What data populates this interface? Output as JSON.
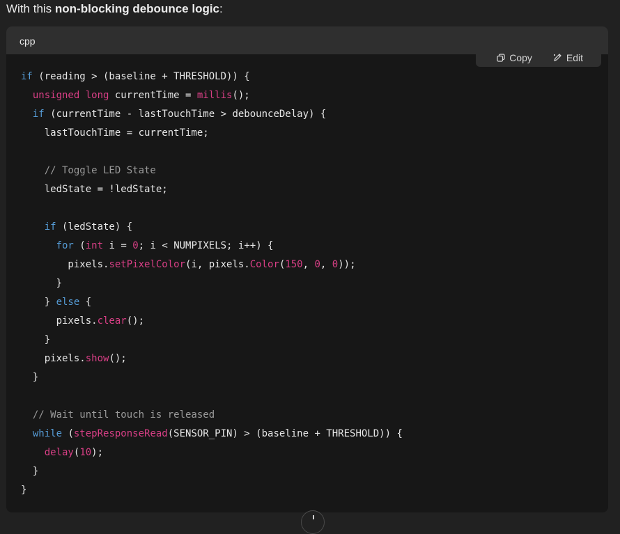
{
  "intro": {
    "prefix": "With this ",
    "bold": "non-blocking debounce logic",
    "suffix": ":"
  },
  "code_block": {
    "language": "cpp",
    "copy_label": "Copy",
    "edit_label": "Edit",
    "icons": {
      "copy": "copy-icon",
      "edit": "edit-icon"
    },
    "colors": {
      "keyword": "#569cd6",
      "type_fn_number": "#d93f86",
      "comment": "#9a9a9a",
      "text": "#e6e6e6",
      "background": "#171717",
      "header": "#2f2f2f"
    },
    "lines": [
      [
        [
          "kw",
          "if"
        ],
        [
          "p",
          " (reading > (baseline + THRESHOLD)) {"
        ]
      ],
      [
        [
          "p",
          "  "
        ],
        [
          "type",
          "unsigned long"
        ],
        [
          "p",
          " currentTime = "
        ],
        [
          "fn",
          "millis"
        ],
        [
          "p",
          "();"
        ]
      ],
      [
        [
          "p",
          "  "
        ],
        [
          "kw",
          "if"
        ],
        [
          "p",
          " (currentTime - lastTouchTime > debounceDelay) {"
        ]
      ],
      [
        [
          "p",
          "    lastTouchTime = currentTime;"
        ]
      ],
      [],
      [
        [
          "p",
          "    "
        ],
        [
          "comment",
          "// Toggle LED State"
        ]
      ],
      [
        [
          "p",
          "    ledState = !ledState;"
        ]
      ],
      [],
      [
        [
          "p",
          "    "
        ],
        [
          "kw",
          "if"
        ],
        [
          "p",
          " (ledState) {"
        ]
      ],
      [
        [
          "p",
          "      "
        ],
        [
          "kw",
          "for"
        ],
        [
          "p",
          " ("
        ],
        [
          "type",
          "int"
        ],
        [
          "p",
          " i = "
        ],
        [
          "num",
          "0"
        ],
        [
          "p",
          "; i < NUMPIXELS; i++) {"
        ]
      ],
      [
        [
          "p",
          "        pixels."
        ],
        [
          "fn",
          "setPixelColor"
        ],
        [
          "p",
          "(i, pixels."
        ],
        [
          "fn",
          "Color"
        ],
        [
          "p",
          "("
        ],
        [
          "num",
          "150"
        ],
        [
          "p",
          ", "
        ],
        [
          "num",
          "0"
        ],
        [
          "p",
          ", "
        ],
        [
          "num",
          "0"
        ],
        [
          "p",
          "));"
        ]
      ],
      [
        [
          "p",
          "      }"
        ]
      ],
      [
        [
          "p",
          "    } "
        ],
        [
          "kw",
          "else"
        ],
        [
          "p",
          " {"
        ]
      ],
      [
        [
          "p",
          "      pixels."
        ],
        [
          "fn",
          "clear"
        ],
        [
          "p",
          "();"
        ]
      ],
      [
        [
          "p",
          "    }"
        ]
      ],
      [
        [
          "p",
          "    pixels."
        ],
        [
          "fn",
          "show"
        ],
        [
          "p",
          "();"
        ]
      ],
      [
        [
          "p",
          "  }"
        ]
      ],
      [],
      [
        [
          "p",
          "  "
        ],
        [
          "comment",
          "// Wait until touch is released"
        ]
      ],
      [
        [
          "p",
          "  "
        ],
        [
          "kw",
          "while"
        ],
        [
          "p",
          " ("
        ],
        [
          "fn",
          "stepResponseRead"
        ],
        [
          "p",
          "(SENSOR_PIN) > (baseline + THRESHOLD)) {"
        ]
      ],
      [
        [
          "p",
          "    "
        ],
        [
          "fn",
          "delay"
        ],
        [
          "p",
          "("
        ],
        [
          "num",
          "10"
        ],
        [
          "p",
          ");"
        ]
      ],
      [
        [
          "p",
          "  }"
        ]
      ],
      [
        [
          "p",
          "}"
        ]
      ]
    ]
  },
  "scroll_button": {
    "icon": "arrow-down-icon"
  }
}
